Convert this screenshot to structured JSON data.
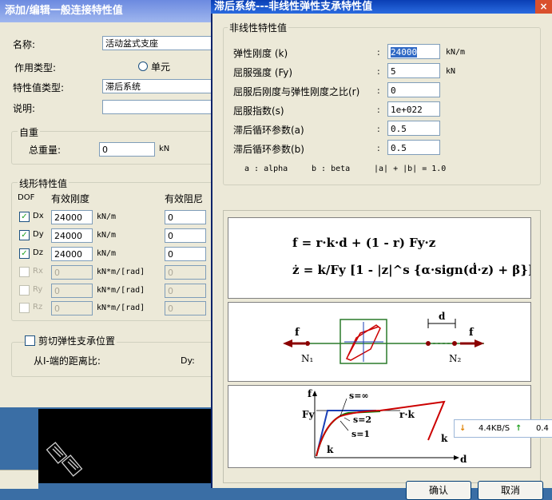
{
  "back_window": {
    "title": "添加/编辑一般连接特性值",
    "name_label": "名称:",
    "name_value": "活动盆式支座",
    "action_type_label": "作用类型:",
    "action_type_option": "单元",
    "prop_type_label": "特性值类型:",
    "prop_type_value": "滞后系统",
    "desc_label": "说明:",
    "self_weight_group": "自重",
    "total_weight_label": "总重量:",
    "total_weight_value": "0",
    "total_weight_unit": "kN",
    "linear_group": "线形特性值",
    "dof_header": "DOF",
    "eff_stiff_header": "有效刚度",
    "eff_damp_header": "有效阻尼",
    "dof_rows": [
      {
        "name": "Dx",
        "checked": true,
        "stiff": "24000",
        "unit": "kN/m",
        "damp": "0"
      },
      {
        "name": "Dy",
        "checked": true,
        "stiff": "24000",
        "unit": "kN/m",
        "damp": "0"
      },
      {
        "name": "Dz",
        "checked": true,
        "stiff": "24000",
        "unit": "kN/m",
        "damp": "0"
      },
      {
        "name": "Rx",
        "checked": false,
        "stiff": "0",
        "unit": "kN*m/[rad]",
        "damp": "0"
      },
      {
        "name": "Ry",
        "checked": false,
        "stiff": "0",
        "unit": "kN*m/[rad]",
        "damp": "0"
      },
      {
        "name": "Rz",
        "checked": false,
        "stiff": "0",
        "unit": "kN*m/[rad]",
        "damp": "0"
      }
    ],
    "shear_label": "剪切弹性支承位置",
    "distance_label": "从I-端的距离比:",
    "dy_label": "Dy:"
  },
  "front_window": {
    "title": "滞后系统---非线性弹性支承特性值",
    "close_glyph": "×",
    "group": "非线性特性值",
    "params": [
      {
        "label": "弹性刚度 (k)",
        "value": "24000",
        "unit": "kN/m",
        "selected": true
      },
      {
        "label": "屈服强度 (Fy)",
        "value": "5",
        "unit": "kN",
        "selected": false
      },
      {
        "label": "屈服后刚度与弹性刚度之比(r)",
        "value": "0",
        "unit": "",
        "selected": false
      },
      {
        "label": "屈服指数(s)",
        "value": "1e+022",
        "unit": "",
        "selected": false
      },
      {
        "label": "滞后循环参数(a)",
        "value": "0.5",
        "unit": "",
        "selected": false
      },
      {
        "label": "滞后循环参数(b)",
        "value": "0.5",
        "unit": "",
        "selected": false
      }
    ],
    "colon": ":",
    "alpha_note": "a : alpha",
    "beta_note": "b : beta",
    "sum_note": "|a| + |b| = 1.0",
    "formula_line1": "f = r·k·d + (1 - r) Fy·z",
    "formula_line2": "ż = k/Fy [1 - |z|^s {α·sign(ḋ·z) + β}] ḋ",
    "diagram": {
      "f_left": "f",
      "f_right": "f",
      "d": "d",
      "n1": "N₁",
      "n2": "N₂"
    },
    "curve": {
      "f_axis": "f",
      "fy": "Fy",
      "k1": "k",
      "k2": "k",
      "s_inf": "s=∞",
      "s2": "s=2",
      "s1": "s=1",
      "rk": "r·k",
      "d_axis": "d"
    },
    "ok_button": "确认",
    "cancel_button": "取消"
  },
  "tray": {
    "down_speed": "4.4KB/S",
    "up_speed": "0.4"
  },
  "colors": {
    "title_blue": "#0a3fb5",
    "curve_red": "#cc0000",
    "curve_green": "#008000",
    "node_red": "#8b0000"
  }
}
